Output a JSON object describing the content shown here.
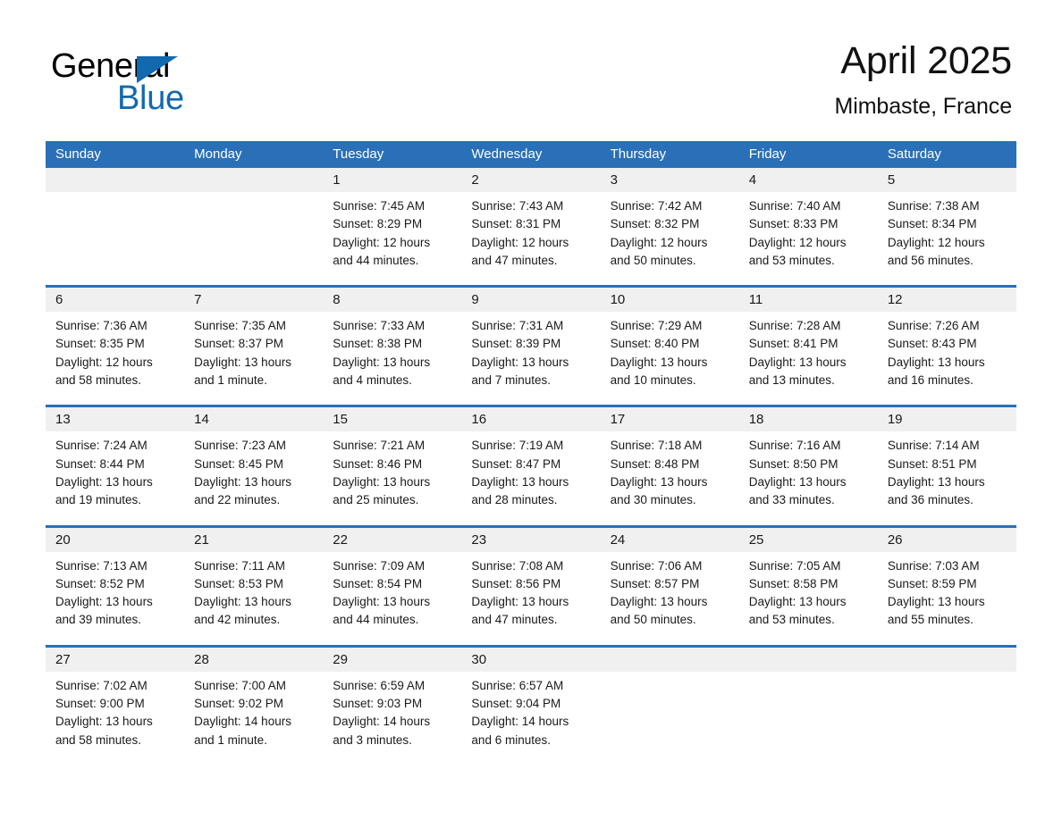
{
  "brand": {
    "name_dark": "General",
    "name_light": "Blue",
    "logo_icon": "triangle-icon",
    "accent_color": "#1169b0"
  },
  "header": {
    "month_title": "April 2025",
    "location": "Mimbaste, France"
  },
  "theme": {
    "header_blue": "#2a70b8",
    "daynum_band": "#f0f0f0",
    "text": "#1a1a1a"
  },
  "calendar": {
    "weekdays": [
      "Sunday",
      "Monday",
      "Tuesday",
      "Wednesday",
      "Thursday",
      "Friday",
      "Saturday"
    ],
    "weeks": [
      [
        {
          "day": "",
          "lines": []
        },
        {
          "day": "",
          "lines": []
        },
        {
          "day": "1",
          "lines": [
            "Sunrise: 7:45 AM",
            "Sunset: 8:29 PM",
            "Daylight: 12 hours",
            "and 44 minutes."
          ]
        },
        {
          "day": "2",
          "lines": [
            "Sunrise: 7:43 AM",
            "Sunset: 8:31 PM",
            "Daylight: 12 hours",
            "and 47 minutes."
          ]
        },
        {
          "day": "3",
          "lines": [
            "Sunrise: 7:42 AM",
            "Sunset: 8:32 PM",
            "Daylight: 12 hours",
            "and 50 minutes."
          ]
        },
        {
          "day": "4",
          "lines": [
            "Sunrise: 7:40 AM",
            "Sunset: 8:33 PM",
            "Daylight: 12 hours",
            "and 53 minutes."
          ]
        },
        {
          "day": "5",
          "lines": [
            "Sunrise: 7:38 AM",
            "Sunset: 8:34 PM",
            "Daylight: 12 hours",
            "and 56 minutes."
          ]
        }
      ],
      [
        {
          "day": "6",
          "lines": [
            "Sunrise: 7:36 AM",
            "Sunset: 8:35 PM",
            "Daylight: 12 hours",
            "and 58 minutes."
          ]
        },
        {
          "day": "7",
          "lines": [
            "Sunrise: 7:35 AM",
            "Sunset: 8:37 PM",
            "Daylight: 13 hours",
            "and 1 minute."
          ]
        },
        {
          "day": "8",
          "lines": [
            "Sunrise: 7:33 AM",
            "Sunset: 8:38 PM",
            "Daylight: 13 hours",
            "and 4 minutes."
          ]
        },
        {
          "day": "9",
          "lines": [
            "Sunrise: 7:31 AM",
            "Sunset: 8:39 PM",
            "Daylight: 13 hours",
            "and 7 minutes."
          ]
        },
        {
          "day": "10",
          "lines": [
            "Sunrise: 7:29 AM",
            "Sunset: 8:40 PM",
            "Daylight: 13 hours",
            "and 10 minutes."
          ]
        },
        {
          "day": "11",
          "lines": [
            "Sunrise: 7:28 AM",
            "Sunset: 8:41 PM",
            "Daylight: 13 hours",
            "and 13 minutes."
          ]
        },
        {
          "day": "12",
          "lines": [
            "Sunrise: 7:26 AM",
            "Sunset: 8:43 PM",
            "Daylight: 13 hours",
            "and 16 minutes."
          ]
        }
      ],
      [
        {
          "day": "13",
          "lines": [
            "Sunrise: 7:24 AM",
            "Sunset: 8:44 PM",
            "Daylight: 13 hours",
            "and 19 minutes."
          ]
        },
        {
          "day": "14",
          "lines": [
            "Sunrise: 7:23 AM",
            "Sunset: 8:45 PM",
            "Daylight: 13 hours",
            "and 22 minutes."
          ]
        },
        {
          "day": "15",
          "lines": [
            "Sunrise: 7:21 AM",
            "Sunset: 8:46 PM",
            "Daylight: 13 hours",
            "and 25 minutes."
          ]
        },
        {
          "day": "16",
          "lines": [
            "Sunrise: 7:19 AM",
            "Sunset: 8:47 PM",
            "Daylight: 13 hours",
            "and 28 minutes."
          ]
        },
        {
          "day": "17",
          "lines": [
            "Sunrise: 7:18 AM",
            "Sunset: 8:48 PM",
            "Daylight: 13 hours",
            "and 30 minutes."
          ]
        },
        {
          "day": "18",
          "lines": [
            "Sunrise: 7:16 AM",
            "Sunset: 8:50 PM",
            "Daylight: 13 hours",
            "and 33 minutes."
          ]
        },
        {
          "day": "19",
          "lines": [
            "Sunrise: 7:14 AM",
            "Sunset: 8:51 PM",
            "Daylight: 13 hours",
            "and 36 minutes."
          ]
        }
      ],
      [
        {
          "day": "20",
          "lines": [
            "Sunrise: 7:13 AM",
            "Sunset: 8:52 PM",
            "Daylight: 13 hours",
            "and 39 minutes."
          ]
        },
        {
          "day": "21",
          "lines": [
            "Sunrise: 7:11 AM",
            "Sunset: 8:53 PM",
            "Daylight: 13 hours",
            "and 42 minutes."
          ]
        },
        {
          "day": "22",
          "lines": [
            "Sunrise: 7:09 AM",
            "Sunset: 8:54 PM",
            "Daylight: 13 hours",
            "and 44 minutes."
          ]
        },
        {
          "day": "23",
          "lines": [
            "Sunrise: 7:08 AM",
            "Sunset: 8:56 PM",
            "Daylight: 13 hours",
            "and 47 minutes."
          ]
        },
        {
          "day": "24",
          "lines": [
            "Sunrise: 7:06 AM",
            "Sunset: 8:57 PM",
            "Daylight: 13 hours",
            "and 50 minutes."
          ]
        },
        {
          "day": "25",
          "lines": [
            "Sunrise: 7:05 AM",
            "Sunset: 8:58 PM",
            "Daylight: 13 hours",
            "and 53 minutes."
          ]
        },
        {
          "day": "26",
          "lines": [
            "Sunrise: 7:03 AM",
            "Sunset: 8:59 PM",
            "Daylight: 13 hours",
            "and 55 minutes."
          ]
        }
      ],
      [
        {
          "day": "27",
          "lines": [
            "Sunrise: 7:02 AM",
            "Sunset: 9:00 PM",
            "Daylight: 13 hours",
            "and 58 minutes."
          ]
        },
        {
          "day": "28",
          "lines": [
            "Sunrise: 7:00 AM",
            "Sunset: 9:02 PM",
            "Daylight: 14 hours",
            "and 1 minute."
          ]
        },
        {
          "day": "29",
          "lines": [
            "Sunrise: 6:59 AM",
            "Sunset: 9:03 PM",
            "Daylight: 14 hours",
            "and 3 minutes."
          ]
        },
        {
          "day": "30",
          "lines": [
            "Sunrise: 6:57 AM",
            "Sunset: 9:04 PM",
            "Daylight: 14 hours",
            "and 6 minutes."
          ]
        },
        {
          "day": "",
          "lines": []
        },
        {
          "day": "",
          "lines": []
        },
        {
          "day": "",
          "lines": []
        }
      ]
    ]
  }
}
